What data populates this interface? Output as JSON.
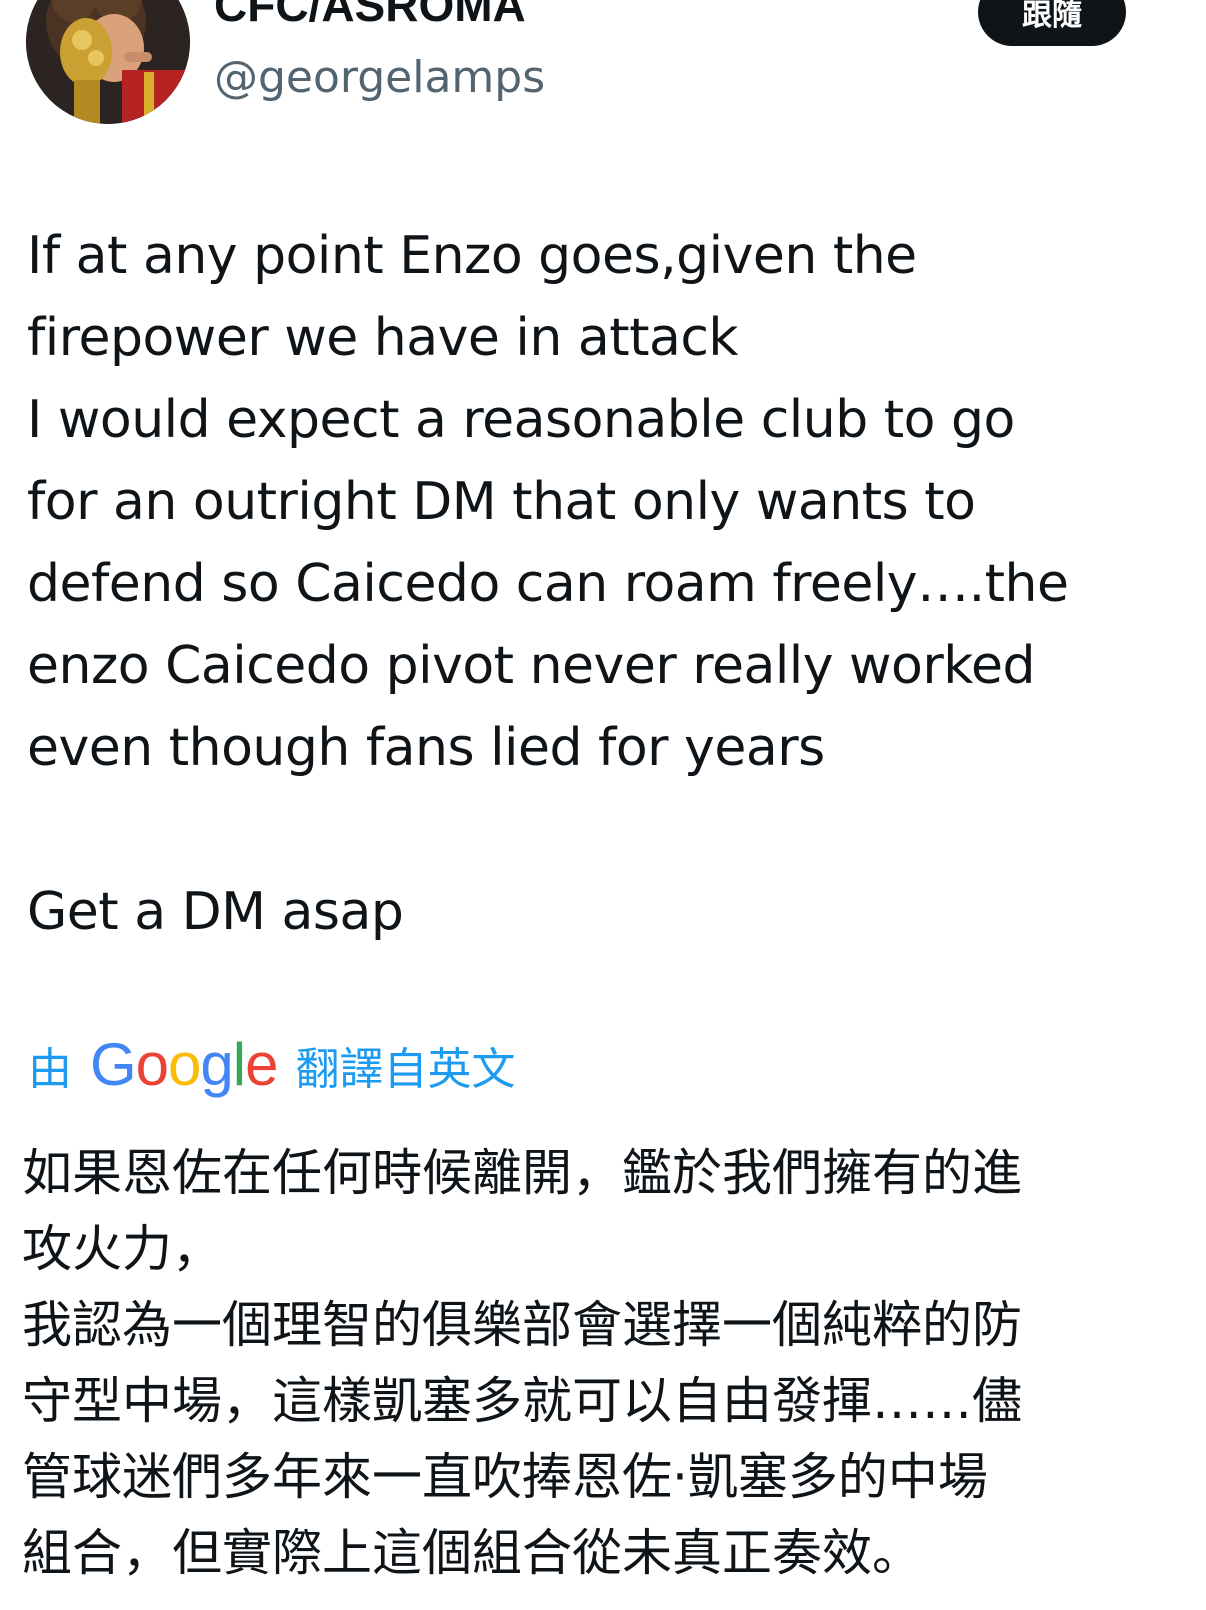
{
  "author": {
    "display_name": "CFC/ASROMA",
    "handle": "@georgelamps",
    "avatar_icon": "profile-avatar-trophy-kiss"
  },
  "follow_button": {
    "label": "跟隨"
  },
  "tweet": {
    "text": "If at any point Enzo goes,given the\nfirepower we have in attack\nI would expect a reasonable club to go\nfor an outright DM that only wants to\ndefend so Caicedo can roam freely….the\nenzo Caicedo pivot never really worked\neven though fans lied for years\n\nGet a DM asap"
  },
  "translation": {
    "prefix": "由",
    "logo": {
      "G": "G",
      "o1": "o",
      "o2": "o",
      "g": "g",
      "l": "l",
      "e": "e"
    },
    "suffix": "翻譯自英文",
    "text": "如果恩佐在任何時候離開，鑑於我們擁有的進\n攻火力，\n我認為一個理智的俱樂部會選擇一個純粹的防\n守型中場，這樣凱塞多就可以自由發揮……儘\n管球迷們多年來一直吹捧恩佐·凱塞多的中場\n組合，但實際上這個組合從未真正奏效。"
  },
  "colors": {
    "text_primary": "#0f1419",
    "text_secondary": "#536471",
    "link_blue": "#1d9bf0",
    "follow_bg": "#0f1419",
    "google_blue": "#4285f4",
    "google_red": "#ea4335",
    "google_yellow": "#fbbc05",
    "google_green": "#34a853"
  }
}
